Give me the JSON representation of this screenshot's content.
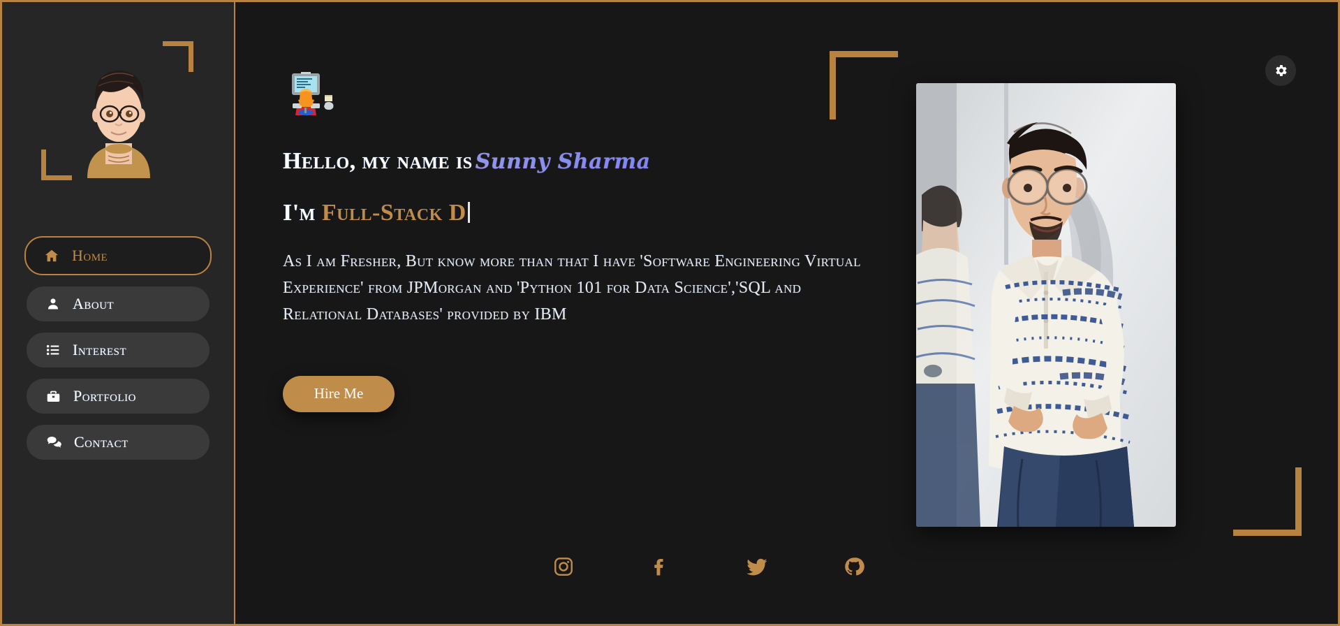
{
  "theme": {
    "gold": "#c08c4a",
    "gold_border": "#b8833f",
    "sidebar_bg": "#262626",
    "main_bg": "#171717",
    "nav_pill_bg": "#3a3a3a",
    "text": "#ffffff",
    "name_gradient_start": "#e87fb4",
    "name_gradient_end": "#b03fd6"
  },
  "sidebar": {
    "avatar_name": "cartoon-avatar-with-glasses",
    "items": [
      {
        "label": "Home",
        "icon": "home-icon",
        "active": true
      },
      {
        "label": "About",
        "icon": "person-icon",
        "active": false
      },
      {
        "label": "Interest",
        "icon": "list-icon",
        "active": false
      },
      {
        "label": "Portfolio",
        "icon": "briefcase-icon",
        "active": false
      },
      {
        "label": "Contact",
        "icon": "chat-icon",
        "active": false
      }
    ]
  },
  "main": {
    "settings_icon": "gear-icon",
    "coder_emoji": "technologist-at-computer-emoji",
    "greeting": "Hello, my name is",
    "name": "Sunny Sharma",
    "typed_prefix": "I'm",
    "typed_text": "Full-Stack D",
    "typed_cursor": "|",
    "bio": "As I am Fresher, But know more than that I have 'Software Engineering Virtual Experience' from JPMorgan and 'Python 101 for Data Science','SQL and Relational Databases' provided by IBM",
    "hire_label": "Hire Me",
    "photo_alt": "portrait-photo-of-young-man-leaning-on-wall"
  },
  "socials": [
    {
      "name": "instagram",
      "label": "Instagram"
    },
    {
      "name": "facebook",
      "label": "Facebook"
    },
    {
      "name": "twitter",
      "label": "Twitter"
    },
    {
      "name": "github",
      "label": "GitHub"
    }
  ]
}
